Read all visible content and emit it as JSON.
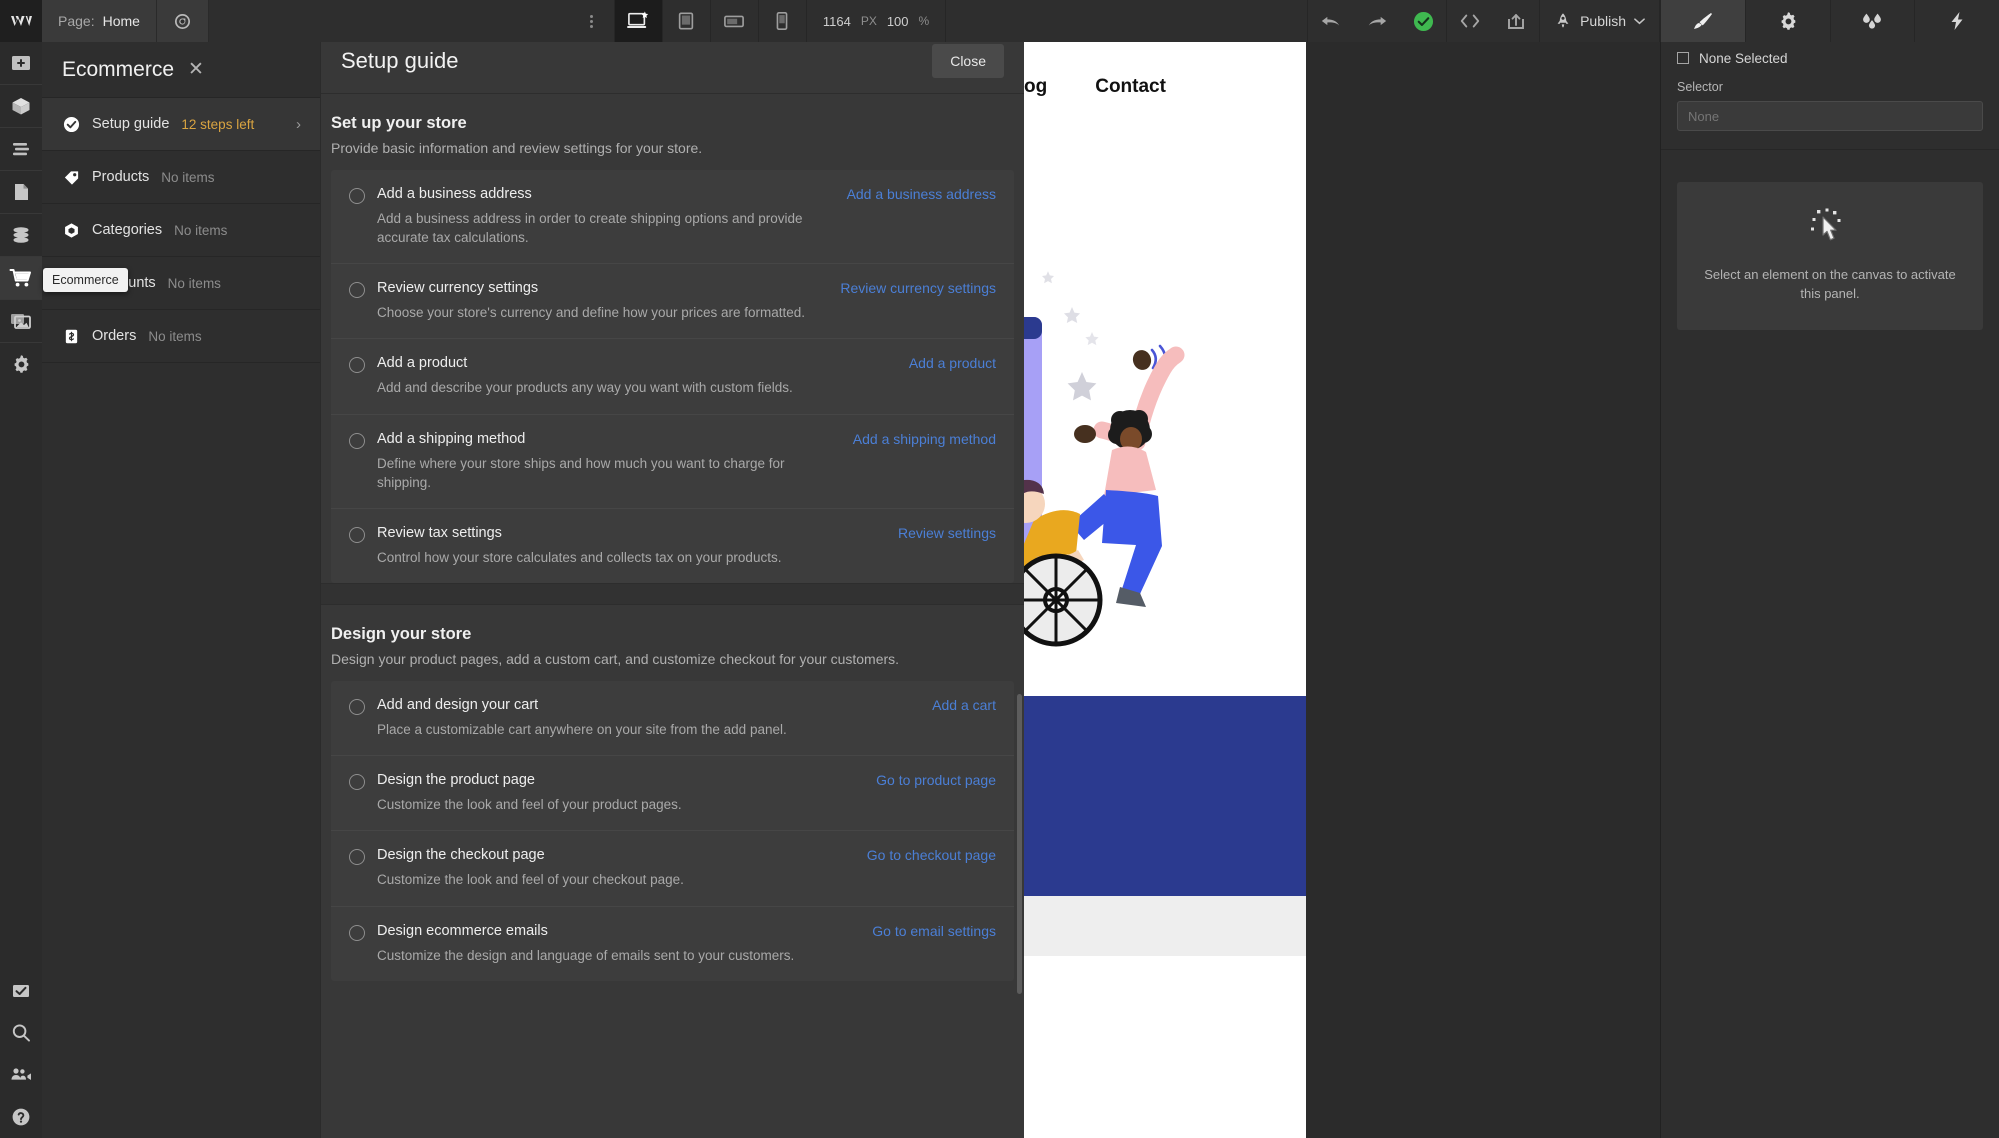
{
  "topbar": {
    "logo": "W",
    "page_label": "Page:",
    "page_value": "Home",
    "preview_icon": "eye-preview-icon",
    "menu_icon": "kebab-menu-icon",
    "breakpoints": [
      {
        "name": "desktop",
        "label": "Desktop",
        "active": true
      },
      {
        "name": "tablet",
        "label": "Tablet",
        "active": false
      },
      {
        "name": "mobile-landscape",
        "label": "Mobile landscape",
        "active": false
      },
      {
        "name": "mobile-portrait",
        "label": "Mobile portrait",
        "active": false
      }
    ],
    "canvas_width": "1164",
    "canvas_width_unit": "PX",
    "zoom_level": "100",
    "zoom_unit": "%",
    "undo_icon": "undo-arrow-icon",
    "redo_icon": "redo-arrow-icon",
    "saved_icon": "saved-check-icon",
    "code_icon": "code-brackets-icon",
    "share_icon": "share-export-icon",
    "publish_icon": "rocket-icon",
    "publish_label": "Publish",
    "publish_chevron": "chevron-down-icon",
    "panel_tabs": [
      {
        "name": "style",
        "icon": "paint-brush-icon",
        "active": true
      },
      {
        "name": "settings",
        "icon": "gear-icon",
        "active": false
      },
      {
        "name": "style-manager",
        "icon": "water-drops-icon",
        "active": false
      },
      {
        "name": "interactions",
        "icon": "lightning-bolt-icon",
        "active": false
      }
    ],
    "accent_saved": "#3fb950"
  },
  "rail": {
    "items": [
      {
        "name": "add",
        "icon": "plus-square-icon",
        "active": false
      },
      {
        "name": "components",
        "icon": "cube-icon",
        "active": false
      },
      {
        "name": "navigator",
        "icon": "layers-icon",
        "active": false
      },
      {
        "name": "pages",
        "icon": "page-document-icon",
        "active": false
      },
      {
        "name": "cms",
        "icon": "database-icon",
        "active": false
      },
      {
        "name": "ecommerce",
        "icon": "shopping-cart-icon",
        "active": true
      },
      {
        "name": "assets",
        "icon": "images-icon",
        "active": false
      },
      {
        "name": "settings",
        "icon": "gear-icon",
        "active": false
      }
    ],
    "bottom_items": [
      {
        "name": "audit",
        "icon": "checkbox-check-icon"
      },
      {
        "name": "search",
        "icon": "search-icon"
      },
      {
        "name": "team",
        "icon": "people-video-icon"
      },
      {
        "name": "help",
        "icon": "question-circle-icon"
      }
    ]
  },
  "tooltip": {
    "text": "Ecommerce"
  },
  "ecommerce": {
    "title": "Ecommerce",
    "close_icon": "close-x-icon",
    "rows": [
      {
        "name": "setup-guide",
        "icon": "check-circle-icon",
        "label": "Setup guide",
        "meta": "12 steps left",
        "meta_warn": true,
        "chevron": "›",
        "active": true
      },
      {
        "name": "products",
        "icon": "tag-icon",
        "label": "Products",
        "meta": "No items",
        "meta_warn": false,
        "chevron": "",
        "active": false
      },
      {
        "name": "categories",
        "icon": "hexagon-icon",
        "label": "Categories",
        "meta": "No items",
        "meta_warn": false,
        "chevron": "",
        "active": false
      },
      {
        "name": "discounts",
        "icon": "discount-icon",
        "label": "Discounts",
        "meta": "No items",
        "meta_warn": false,
        "chevron": "",
        "active": false
      },
      {
        "name": "orders",
        "icon": "orders-receipt-icon",
        "label": "Orders",
        "meta": "No items",
        "meta_warn": false,
        "chevron": "",
        "active": false
      }
    ]
  },
  "guide": {
    "title": "Setup guide",
    "close_label": "Close",
    "sections": [
      {
        "name": "set-up-your-store",
        "title": "Set up your store",
        "desc": "Provide basic information and review settings for your store.",
        "tasks": [
          {
            "name": "add-a-business-address",
            "title": "Add a business address",
            "desc": "Add a business address in order to create shipping options and provide accurate tax calculations.",
            "link": "Add a business address"
          },
          {
            "name": "review-currency-settings",
            "title": "Review currency settings",
            "desc": "Choose your store's currency and define how your prices are formatted.",
            "link": "Review currency settings"
          },
          {
            "name": "add-a-product",
            "title": "Add a product",
            "desc": "Add and describe your products any way you want with custom fields.",
            "link": "Add a product"
          },
          {
            "name": "add-a-shipping-method",
            "title": "Add a shipping method",
            "desc": "Define where your store ships and how much you want to charge for shipping.",
            "link": "Add a shipping method"
          },
          {
            "name": "review-tax-settings",
            "title": "Review tax settings",
            "desc": "Control how your store calculates and collects tax on your products.",
            "link": "Review settings"
          }
        ]
      },
      {
        "name": "design-your-store",
        "title": "Design your store",
        "desc": "Design your product pages, add a custom cart, and customize checkout for your customers.",
        "tasks": [
          {
            "name": "add-and-design-your-cart",
            "title": "Add and design your cart",
            "desc": "Place a customizable cart anywhere on your site from the add panel.",
            "link": "Add a cart"
          },
          {
            "name": "design-the-product-page",
            "title": "Design the product page",
            "desc": "Customize the look and feel of your product pages.",
            "link": "Go to product page"
          },
          {
            "name": "design-the-checkout-page",
            "title": "Design the checkout page",
            "desc": "Customize the look and feel of your checkout page.",
            "link": "Go to checkout page"
          },
          {
            "name": "design-ecommerce-emails",
            "title": "Design ecommerce emails",
            "desc": "Customize the design and language of emails sent to your customers.",
            "link": "Go to email settings"
          }
        ]
      }
    ],
    "link_color": "#4b7fd6"
  },
  "canvas": {
    "site_nav": [
      {
        "name": "blog",
        "label": "og"
      },
      {
        "name": "contact",
        "label": "Contact"
      }
    ],
    "illustration": "people-celebrating-wheelchair-illustration",
    "band_color": "#2b3a8f"
  },
  "right_panel": {
    "selection_label": "None Selected",
    "selector_label": "Selector",
    "selector_value": "None",
    "empty_icon": "click-pointer-icon",
    "empty_text": "Select an element on the canvas to activate this panel."
  }
}
